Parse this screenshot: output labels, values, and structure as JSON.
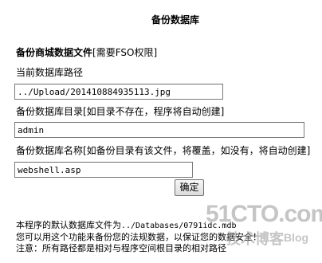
{
  "page": {
    "title": "备份数据库"
  },
  "form": {
    "section_title_bold": "备份商城数据文件",
    "section_title_note": "[需要FSO权限]",
    "current_db_path_label": "当前数据库路径",
    "current_db_path_value": "../Upload/201410884935113.jpg",
    "backup_dir_label": "备份数据库目录[如目录不存在，程序将自动创建]",
    "backup_dir_value": "admin",
    "backup_name_label": "备份数据库名称[如备份目录有该文件，将覆盖，如没有，将自动创建]",
    "backup_name_value": "webshell.asp",
    "confirm_label": "确定"
  },
  "notes": {
    "line1_prefix": "本程序的默认数据库文件为",
    "line1_path": "../Databases/0791idc.mdb",
    "line2": "您可以用这个功能来备份您的法规数据，以保证您的数据安全！",
    "line3": "注意：所有路径都是相对与程序空间根目录的相对路径"
  },
  "watermark": {
    "logo": "51CTO.com",
    "subtitle": "技术博客",
    "blog": "Blog"
  }
}
